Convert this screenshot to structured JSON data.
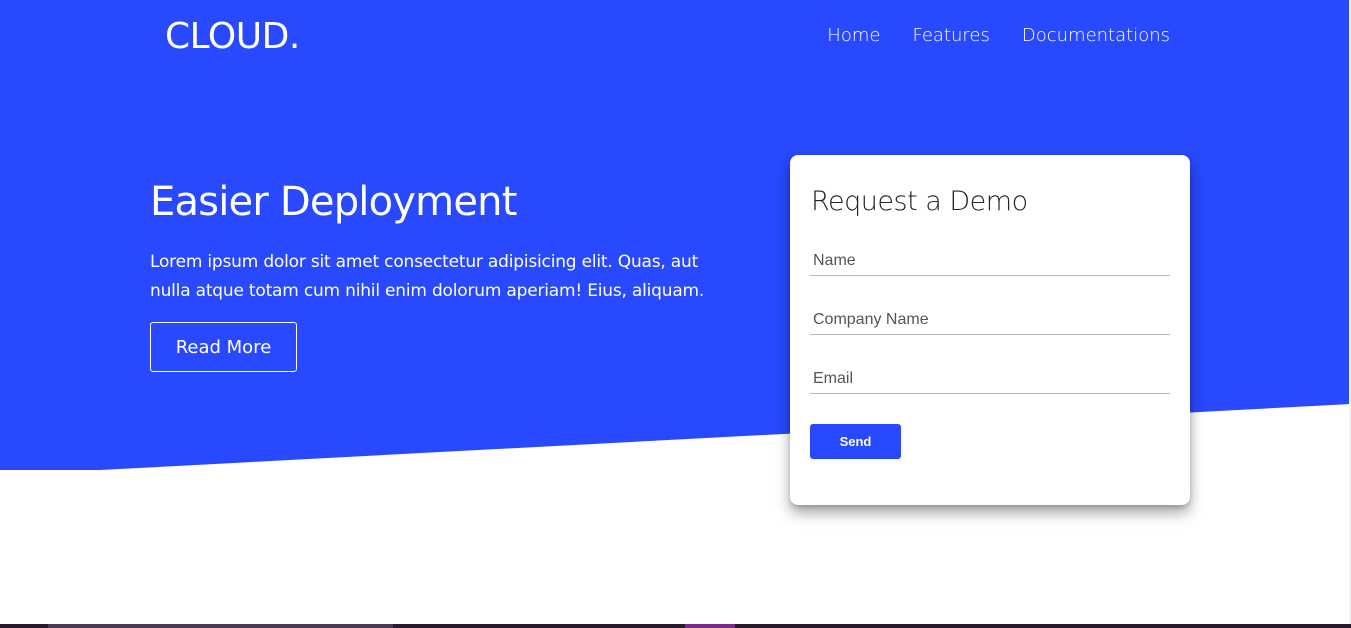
{
  "colors": {
    "brand": "#2849fd",
    "white": "#ffffff"
  },
  "header": {
    "logo": "CLOUD.",
    "nav": [
      {
        "label": "Home"
      },
      {
        "label": "Features"
      },
      {
        "label": "Documentations"
      }
    ]
  },
  "hero": {
    "title": "Easier Deployment",
    "text": "Lorem ipsum dolor sit amet consectetur adipisicing elit. Quas, aut nulla atque totam cum nihil enim dolorum aperiam! Eius, aliquam.",
    "button_label": "Read More"
  },
  "demo_form": {
    "title": "Request a Demo",
    "name_placeholder": "Name",
    "company_placeholder": "Company Name",
    "email_placeholder": "Email",
    "send_label": "Send"
  }
}
